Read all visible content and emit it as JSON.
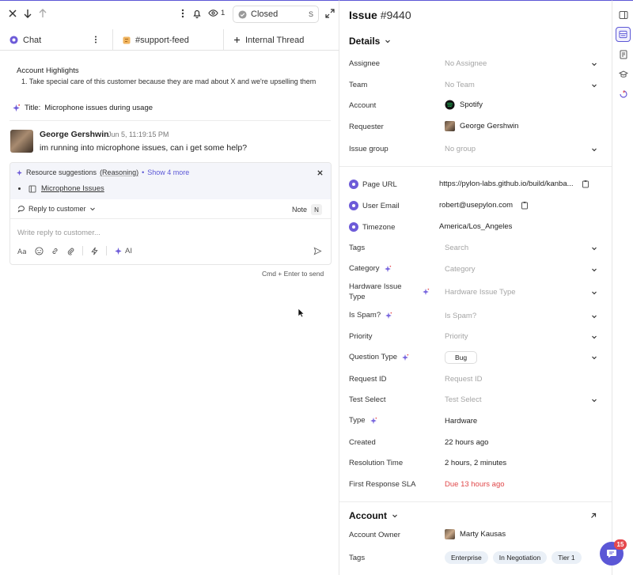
{
  "toolbar": {
    "watchers_count": "1",
    "status": "Closed",
    "status_shortcut": "S"
  },
  "tabs": [
    {
      "label": "Chat"
    },
    {
      "label": "#support-feed"
    },
    {
      "label": "Internal Thread"
    }
  ],
  "highlights": {
    "title": "Account Highlights",
    "items": [
      "1.  Take special care of this customer because they are mad about X and we're upselling them"
    ]
  },
  "thread_title": {
    "label": "Title:",
    "value": "Microphone issues during usage"
  },
  "message": {
    "author": "George Gershwin",
    "time": "Jun 5, 11:19:15 PM",
    "text": "im running into microphone issues, can i get some help?"
  },
  "suggestions": {
    "label": "Resource suggestions",
    "reasoning": "(Reasoning)",
    "bullet": "•",
    "show_more": "Show 4 more",
    "items": [
      "Microphone Issues"
    ]
  },
  "composer": {
    "reply_mode": "Reply to customer",
    "note_label": "Note",
    "note_shortcut": "N",
    "placeholder": "Write reply to customer...",
    "ai_label": "AI",
    "send_hint": "Cmd + Enter to send"
  },
  "issue": {
    "label": "Issue",
    "number": "#9440"
  },
  "details": {
    "heading": "Details",
    "assignee": {
      "label": "Assignee",
      "value": "No Assignee"
    },
    "team": {
      "label": "Team",
      "value": "No Team"
    },
    "account": {
      "label": "Account",
      "value": "Spotify"
    },
    "requester": {
      "label": "Requester",
      "value": "George Gershwin"
    },
    "issue_group": {
      "label": "Issue group",
      "value": "No group"
    },
    "page_url": {
      "label": "Page URL",
      "value": "https://pylon-labs.github.io/build/kanba..."
    },
    "user_email": {
      "label": "User Email",
      "value": "robert@usepylon.com"
    },
    "timezone": {
      "label": "Timezone",
      "value": "America/Los_Angeles"
    },
    "tags": {
      "label": "Tags",
      "value": "Search"
    },
    "category": {
      "label": "Category",
      "value": "Category"
    },
    "hardware_issue_type": {
      "label_line1": "Hardware Issue",
      "label_line2": "Type",
      "value": "Hardware Issue Type"
    },
    "is_spam": {
      "label": "Is Spam?",
      "value": "Is Spam?"
    },
    "priority": {
      "label": "Priority",
      "value": "Priority"
    },
    "question_type": {
      "label": "Question Type",
      "value": "Bug"
    },
    "request_id": {
      "label": "Request ID",
      "value": "Request ID"
    },
    "test_select": {
      "label": "Test Select",
      "value": "Test Select"
    },
    "type": {
      "label": "Type",
      "value": "Hardware"
    },
    "created": {
      "label": "Created",
      "value": "22 hours ago"
    },
    "resolution_time": {
      "label": "Resolution Time",
      "value": "2 hours, 2 minutes"
    },
    "first_response_sla": {
      "label": "First Response SLA",
      "value": "Due 13 hours ago"
    }
  },
  "account_section": {
    "heading": "Account",
    "owner": {
      "label": "Account Owner",
      "value": "Marty Kausas"
    },
    "tags": {
      "label": "Tags",
      "values": [
        "Enterprise",
        "In Negotiation",
        "Tier 1"
      ]
    }
  },
  "fab": {
    "badge": "15"
  },
  "colors": {
    "accent": "#5b57d6",
    "danger": "#e0484a",
    "spotify": "#1db954"
  }
}
